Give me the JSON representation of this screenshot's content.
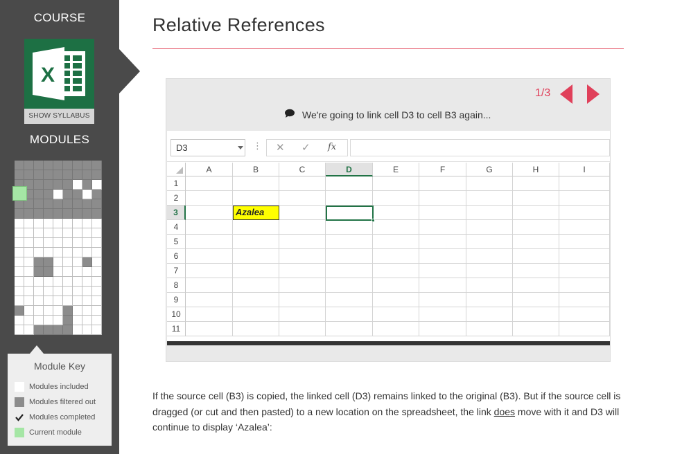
{
  "sidebar": {
    "course_heading": "COURSE",
    "syllabus_button": "SHOW SYLLABUS",
    "modules_heading": "MODULES",
    "module_grid": [
      "fffffffff",
      "fffffffff",
      "ffffffwfw",
      "ffffwffwf",
      "fffffffff",
      "fffffffff",
      "wwwwwwwww",
      "wwwwwwwww",
      "wwwwwwwww",
      "wwwwwwwww",
      "wwffwwwfw",
      "wwffwwwww",
      "wwwwwwwww",
      "wwwwwwwww",
      "wwwwwwwww",
      "fwwwwfwww",
      "wwwwwfwww",
      "wwffffwww"
    ],
    "module_key": {
      "title": "Module Key",
      "items": [
        {
          "label": "Modules included",
          "swatch": "#ffffff"
        },
        {
          "label": "Modules filtered out",
          "swatch": "#8c8c8c"
        },
        {
          "label": "Modules completed",
          "swatch": "check"
        },
        {
          "label": "Current module",
          "swatch": "#a5e6a5"
        }
      ]
    }
  },
  "main": {
    "title": "Relative References",
    "accent_color": "#e34b5f",
    "slide": {
      "counter": "1/3",
      "caption": "We're going to link cell D3 to cell B3 again...",
      "spreadsheet": {
        "name_box": "D3",
        "columns": [
          "A",
          "B",
          "C",
          "D",
          "E",
          "F",
          "G",
          "H",
          "I"
        ],
        "rows": [
          "1",
          "2",
          "3",
          "4",
          "5",
          "6",
          "7",
          "8",
          "9",
          "10",
          "11"
        ],
        "active_column": "D",
        "active_row": "3",
        "cell_b3": "Azalea"
      }
    },
    "body": {
      "part1": "If the source cell (B3) is copied, the linked cell (D3) remains linked to the original (B3). But if the source cell is dragged (or cut and then pasted) to a new location on the spreadsheet, the link ",
      "underlined": "does",
      "part2": " move with it and D3 will continue to display ‘Azalea’:"
    }
  }
}
